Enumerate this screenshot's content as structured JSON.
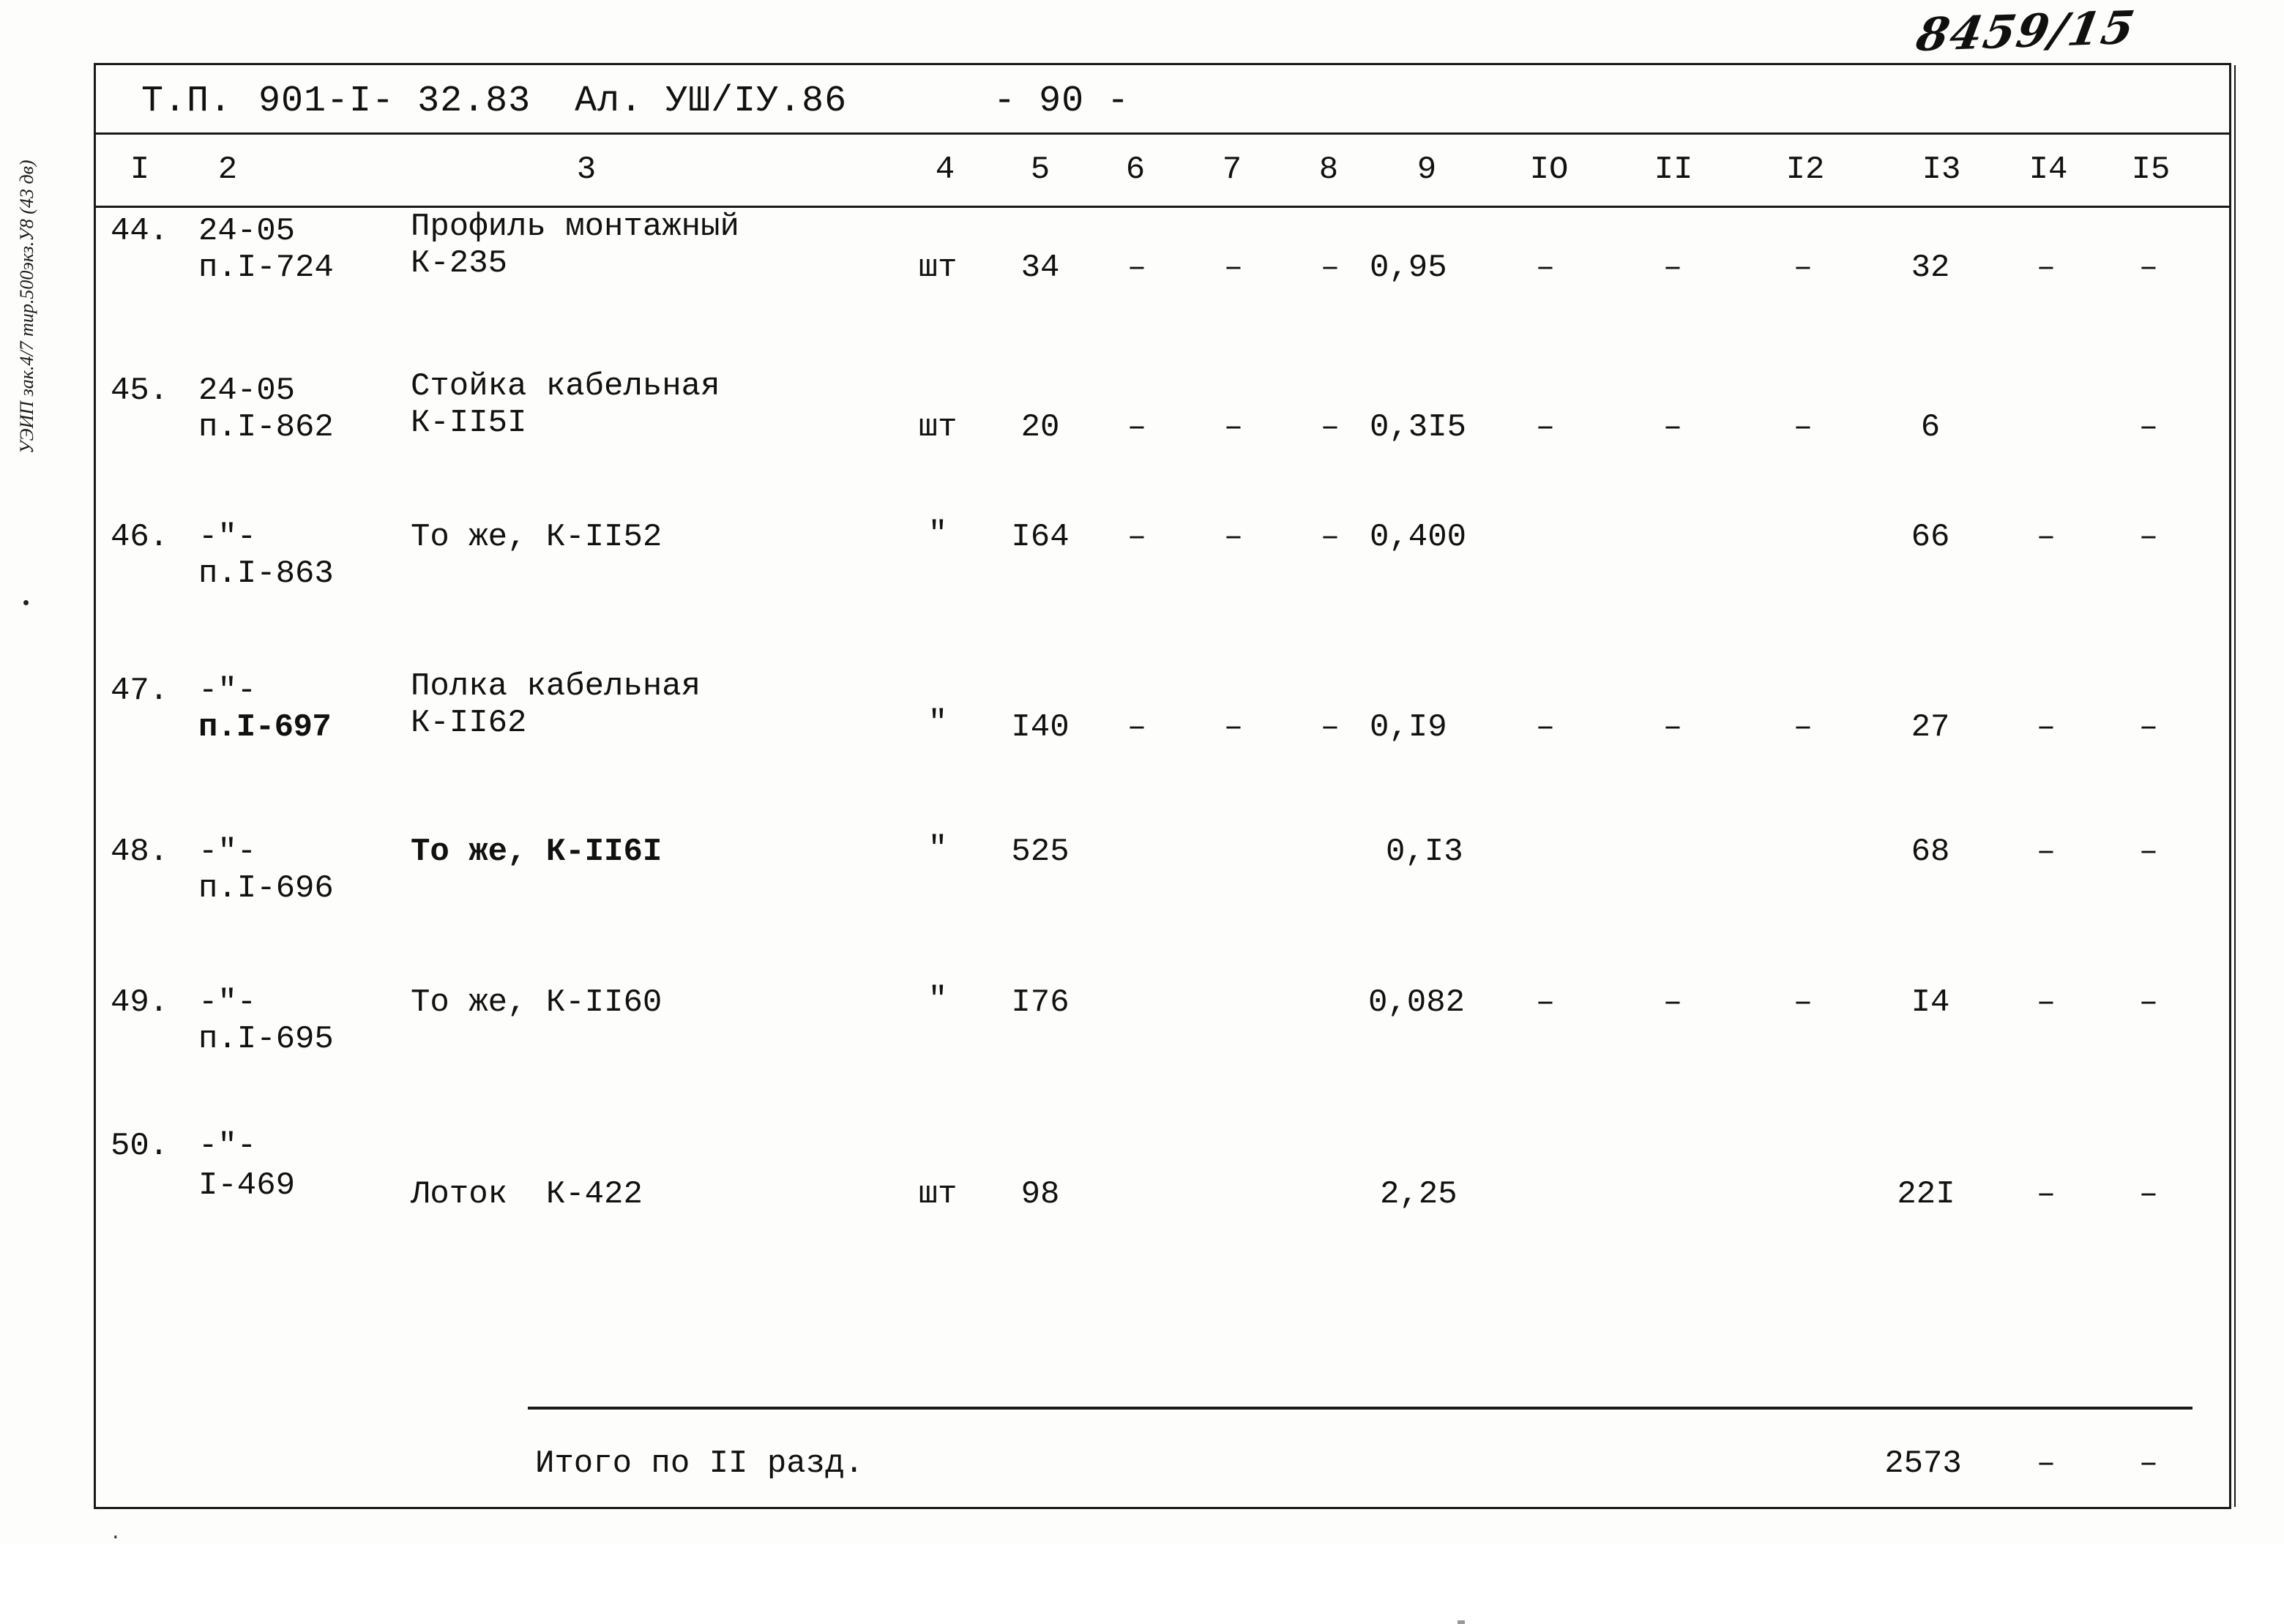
{
  "archive_number": "8459/15",
  "margin": {
    "stamp_text": "УЭИП  зак.4/7  тир.500экз.У8 (43 дв)",
    "tick": "."
  },
  "header": {
    "tp_label": "Т.П.",
    "project_code": "901-I-  32.83",
    "album": "Ал.  УШ/IУ.86",
    "page_number": "- 90 -"
  },
  "columns": [
    "I",
    "2",
    "3",
    "4",
    "5",
    "6",
    "7",
    "8",
    "9",
    "IO",
    "II",
    "I2",
    "I3",
    "I4",
    "I5"
  ],
  "rows": [
    {
      "no": "44.",
      "ref_line1": "24-05",
      "ref_line2": "п.I-724",
      "name_line1": "Профиль монтажный",
      "name_line2": "К-235",
      "unit": "шт",
      "c5": "34",
      "c6": "–",
      "c7": "–",
      "c8": "–",
      "c9": "0,95",
      "c10": "–",
      "c11": "–",
      "c12": "–",
      "c13": "32",
      "c14": "–",
      "c15": "–"
    },
    {
      "no": "45.",
      "ref_line1": "24-05",
      "ref_line2": "п.I-862",
      "name_line1": "Стойка кабельная",
      "name_line2": "К-II5I",
      "unit": "шт",
      "c5": "20",
      "c6": "–",
      "c7": "–",
      "c8": "–",
      "c9": "0,3I5",
      "c10": "–",
      "c11": "–",
      "c12": "–",
      "c13": "6",
      "c14": "",
      "c15": "–"
    },
    {
      "no": "46.",
      "ref_line1": "-\"-",
      "ref_line2": "п.I-863",
      "name_line1": "То же, К-II52",
      "name_line2": "",
      "unit": "\"",
      "c5": "I64",
      "c6": "–",
      "c7": "–",
      "c8": "–",
      "c9": "0,400",
      "c10": "",
      "c11": "",
      "c12": "",
      "c13": "66",
      "c14": "–",
      "c15": "–"
    },
    {
      "no": "47.",
      "ref_line1": "-\"-",
      "ref_line2": "п.I-697",
      "name_line1": "Полка кабельная",
      "name_line2": "К-II62",
      "unit": "\"",
      "c5": "I40",
      "c6": "–",
      "c7": "–",
      "c8": "–",
      "c9": "0,I9",
      "c10": "–",
      "c11": "–",
      "c12": "–",
      "c13": "27",
      "c14": "–",
      "c15": "–"
    },
    {
      "no": "48.",
      "ref_line1": "-\"-",
      "ref_line2": "п.I-696",
      "name_line1": "То же, К-II6I",
      "name_line2": "",
      "unit": "\"",
      "c5": "525",
      "c6": "",
      "c7": "",
      "c8": "",
      "c9": "0,I3",
      "c10": "",
      "c11": "",
      "c12": "",
      "c13": "68",
      "c14": "–",
      "c15": "–"
    },
    {
      "no": "49.",
      "ref_line1": "-\"-",
      "ref_line2": "п.I-695",
      "name_line1": "То же, К-II60",
      "name_line2": "",
      "unit": "\"",
      "c5": "I76",
      "c6": "",
      "c7": "",
      "c8": "",
      "c9": "0,082",
      "c10": "–",
      "c11": "–",
      "c12": "–",
      "c13": "I4",
      "c14": "–",
      "c15": "–"
    },
    {
      "no": "50.",
      "ref_line1": "-\"-",
      "ref_line2": "I-469",
      "name_line1": "Лоток  К-422",
      "name_line2": "",
      "unit": "шт",
      "c5": "98",
      "c6": "",
      "c7": "",
      "c8": "",
      "c9": "2,25",
      "c10": "",
      "c11": "",
      "c12": "",
      "c13": "22I",
      "c14": "–",
      "c15": "–"
    }
  ],
  "total": {
    "label": "Итого по II разд.",
    "c13": "2573",
    "c14": "–",
    "c15": "–"
  }
}
